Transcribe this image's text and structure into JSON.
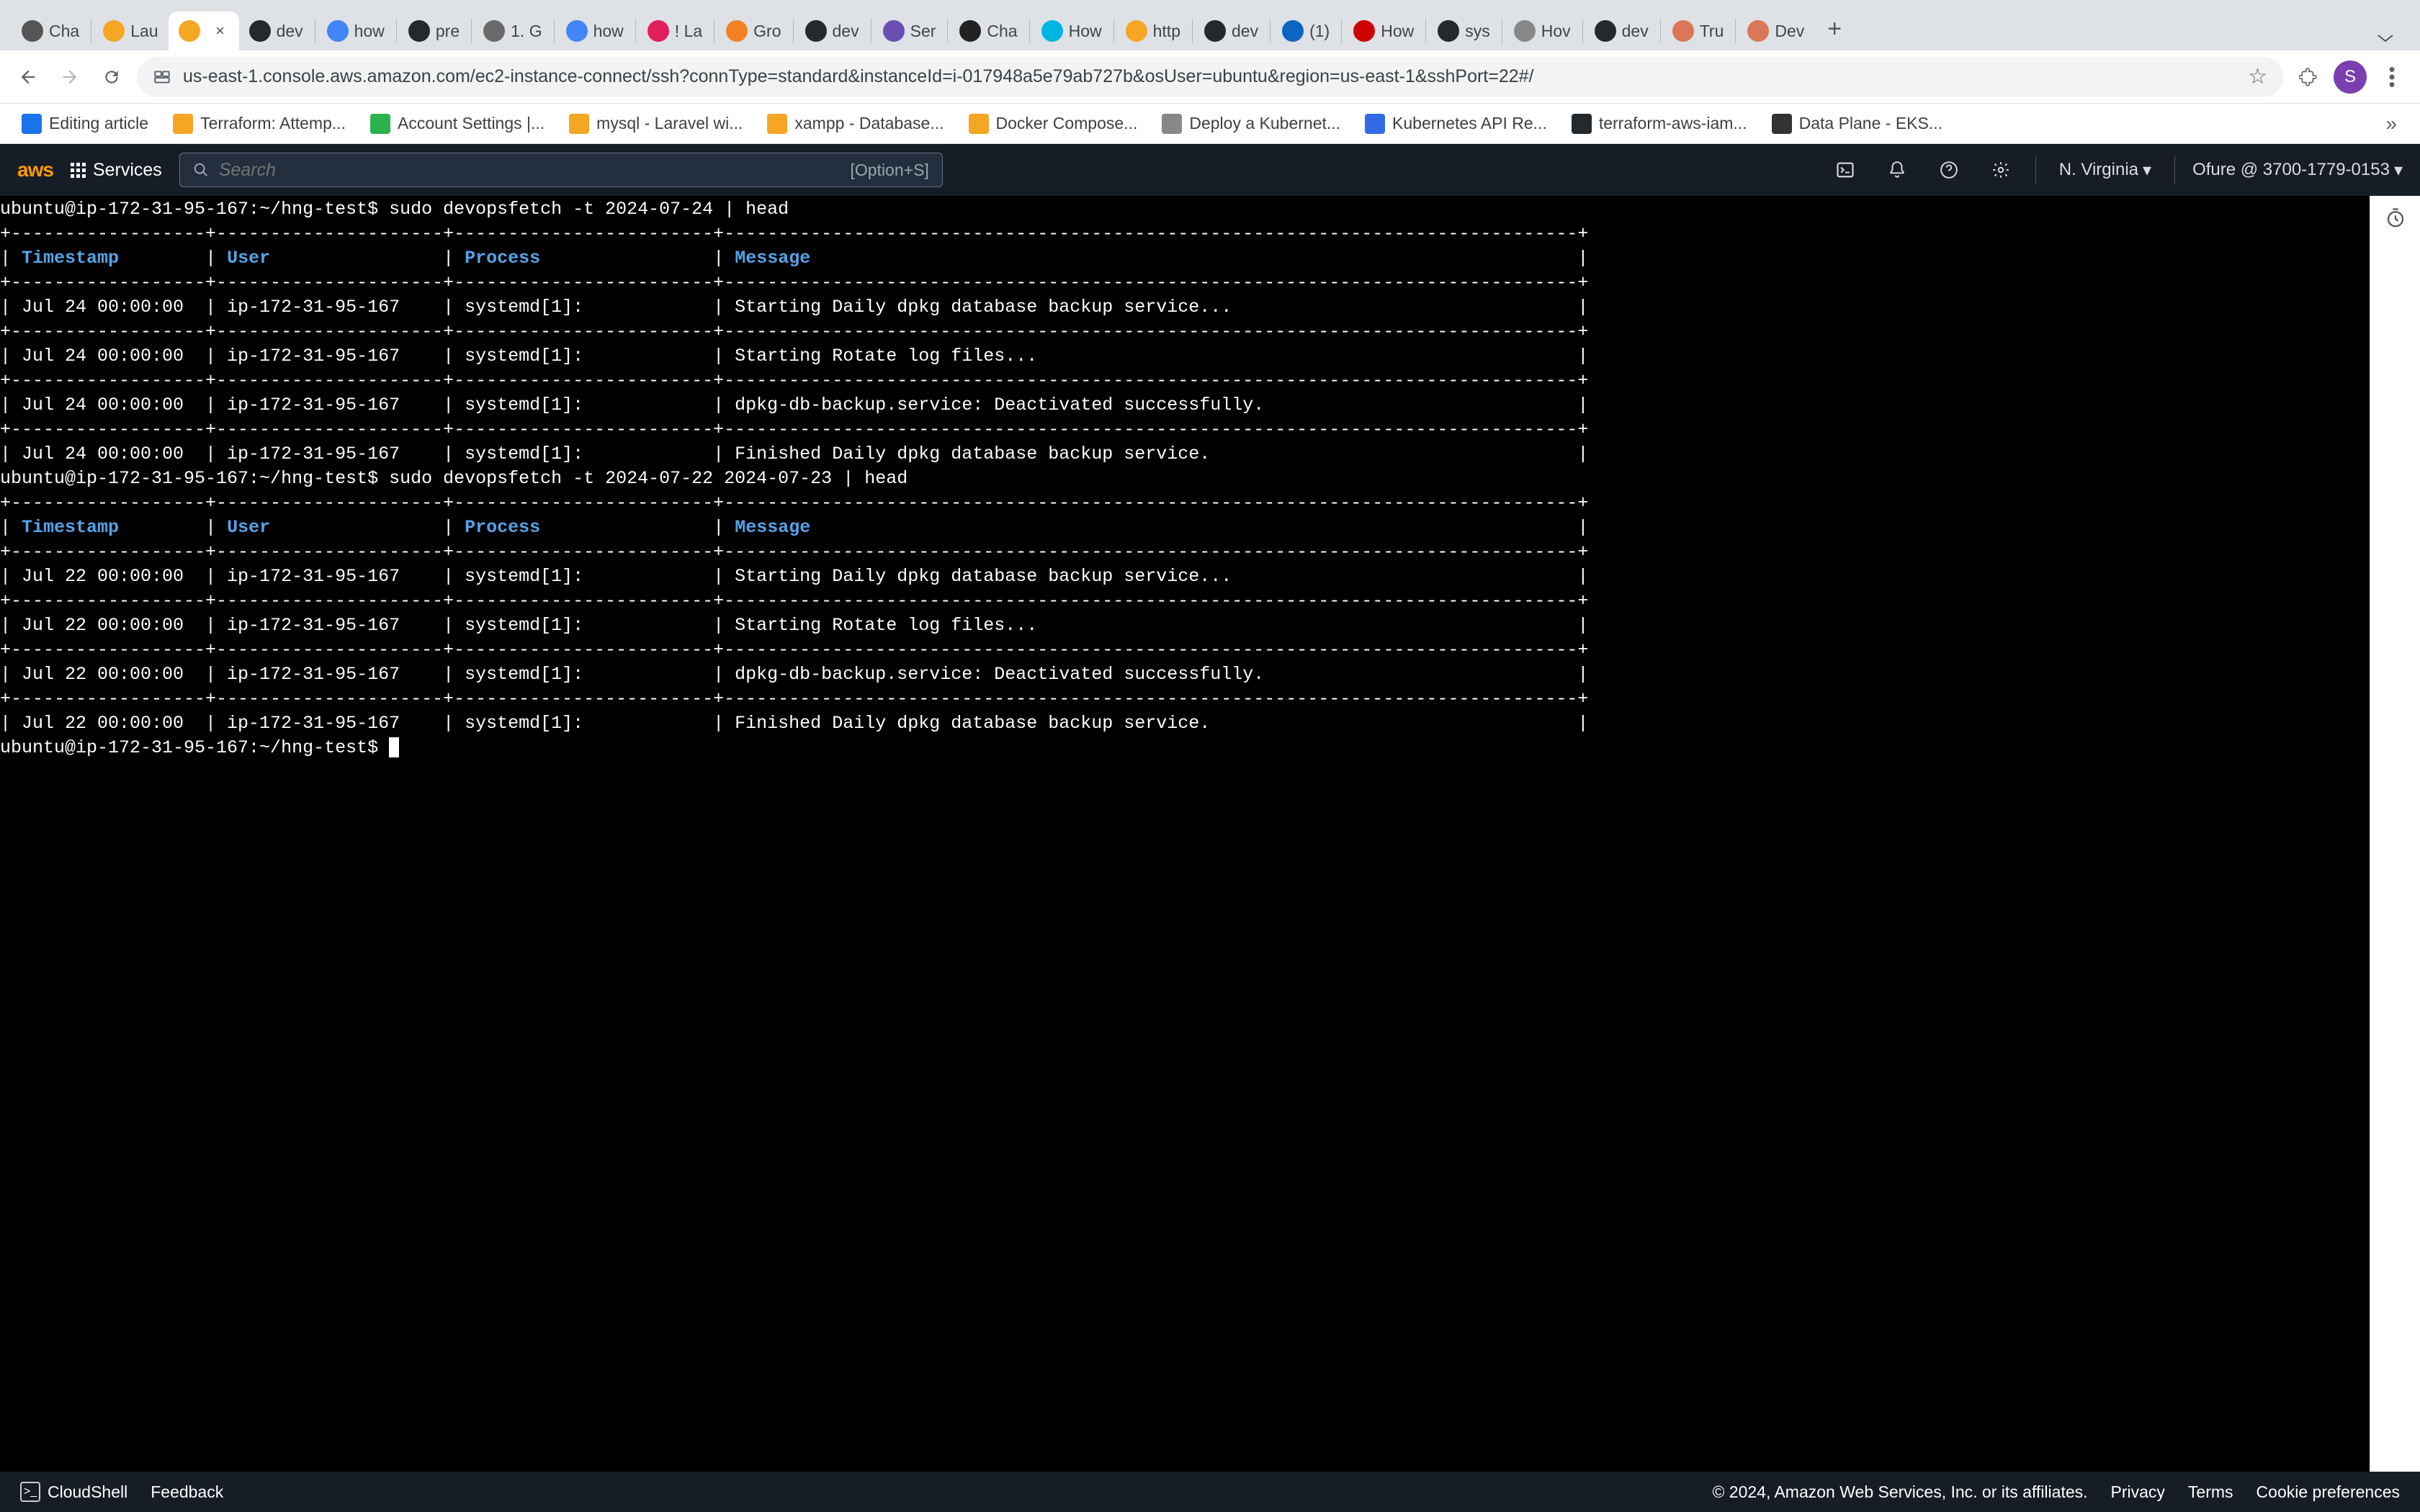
{
  "tabs": [
    {
      "label": "Cha",
      "color": "#555"
    },
    {
      "label": "Lau",
      "color": "#f5a623"
    },
    {
      "label": "",
      "color": "#f5a623",
      "active": true
    },
    {
      "label": "dev",
      "color": "#24292e"
    },
    {
      "label": "how",
      "color": "#4285f4"
    },
    {
      "label": "pre",
      "color": "#24292e"
    },
    {
      "label": "1. G",
      "color": "#6a6a6a"
    },
    {
      "label": "how",
      "color": "#4285f4"
    },
    {
      "label": "! La",
      "color": "#e01e5a"
    },
    {
      "label": "Gro",
      "color": "#f48024"
    },
    {
      "label": "dev",
      "color": "#24292e"
    },
    {
      "label": "Ser",
      "color": "#6a4fb5"
    },
    {
      "label": "Cha",
      "color": "#222"
    },
    {
      "label": "How",
      "color": "#00b5e2"
    },
    {
      "label": "http",
      "color": "#f5a623"
    },
    {
      "label": "dev",
      "color": "#24292e"
    },
    {
      "label": "(1)",
      "color": "#0a66c2"
    },
    {
      "label": "How",
      "color": "#cc0000"
    },
    {
      "label": "sys",
      "color": "#24292e"
    },
    {
      "label": "Hov",
      "color": "#888"
    },
    {
      "label": "dev",
      "color": "#24292e"
    },
    {
      "label": "Tru",
      "color": "#d97757"
    },
    {
      "label": "Dev",
      "color": "#d97757"
    }
  ],
  "url": "us-east-1.console.aws.amazon.com/ec2-instance-connect/ssh?connType=standard&instanceId=i-017948a5e79ab727b&osUser=ubuntu&region=us-east-1&sshPort=22#/",
  "avatar_letter": "S",
  "bookmarks": [
    {
      "label": "Editing article",
      "color": "#1a73e8"
    },
    {
      "label": "Terraform: Attemp...",
      "color": "#f5a623"
    },
    {
      "label": "Account Settings |...",
      "color": "#2bb24c"
    },
    {
      "label": "mysql - Laravel wi...",
      "color": "#f5a623"
    },
    {
      "label": "xampp - Database...",
      "color": "#f5a623"
    },
    {
      "label": "Docker Compose...",
      "color": "#f5a623"
    },
    {
      "label": "Deploy a Kubernet...",
      "color": "#888"
    },
    {
      "label": "Kubernetes API Re...",
      "color": "#326ce5"
    },
    {
      "label": "terraform-aws-iam...",
      "color": "#24292e"
    },
    {
      "label": "Data Plane - EKS...",
      "color": "#333"
    }
  ],
  "aws": {
    "logo": "aws",
    "services": "Services",
    "search_placeholder": "Search",
    "search_hint": "[Option+S]",
    "region": "N. Virginia",
    "account": "Ofure @ 3700-1779-0153"
  },
  "terminal": {
    "prompt_host": "ubuntu@ip-172-31-95-167:~/hng-test$",
    "cmd1": "sudo devopsfetch -t 2024-07-24 | head",
    "cmd2": "sudo devopsfetch -t 2024-07-22 2024-07-23 | head",
    "headers": {
      "ts": "Timestamp",
      "user": "User",
      "process": "Process",
      "message": "Message"
    },
    "border_top": "+------------------+---------------------+------------------------+-------------------------------------------------------------------------------+",
    "border_hdr": "+------------------+---------------------+------------------------+-------------------------------------------------------------------------------+",
    "border_row": "+------------------+---------------------+------------------------+-------------------------------------------------------------------------------+",
    "rows1": [
      {
        "ts": "Jul 24 00:00:00",
        "user": "ip-172-31-95-167",
        "process": "systemd[1]:",
        "message": "Starting Daily dpkg database backup service..."
      },
      {
        "ts": "Jul 24 00:00:00",
        "user": "ip-172-31-95-167",
        "process": "systemd[1]:",
        "message": "Starting Rotate log files..."
      },
      {
        "ts": "Jul 24 00:00:00",
        "user": "ip-172-31-95-167",
        "process": "systemd[1]:",
        "message": "dpkg-db-backup.service: Deactivated successfully."
      },
      {
        "ts": "Jul 24 00:00:00",
        "user": "ip-172-31-95-167",
        "process": "systemd[1]:",
        "message": "Finished Daily dpkg database backup service."
      }
    ],
    "rows2": [
      {
        "ts": "Jul 22 00:00:00",
        "user": "ip-172-31-95-167",
        "process": "systemd[1]:",
        "message": "Starting Daily dpkg database backup service..."
      },
      {
        "ts": "Jul 22 00:00:00",
        "user": "ip-172-31-95-167",
        "process": "systemd[1]:",
        "message": "Starting Rotate log files..."
      },
      {
        "ts": "Jul 22 00:00:00",
        "user": "ip-172-31-95-167",
        "process": "systemd[1]:",
        "message": "dpkg-db-backup.service: Deactivated successfully."
      },
      {
        "ts": "Jul 22 00:00:00",
        "user": "ip-172-31-95-167",
        "process": "systemd[1]:",
        "message": "Finished Daily dpkg database backup service."
      }
    ]
  },
  "footer": {
    "cloudshell": "CloudShell",
    "feedback": "Feedback",
    "copyright": "© 2024, Amazon Web Services, Inc. or its affiliates.",
    "privacy": "Privacy",
    "terms": "Terms",
    "cookies": "Cookie preferences"
  }
}
